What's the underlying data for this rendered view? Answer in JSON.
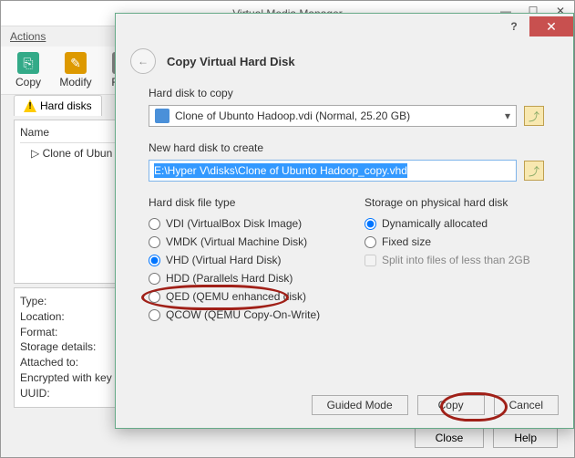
{
  "bg": {
    "title": "Virtual Media Manager",
    "menu_actions": "Actions",
    "toolbar": {
      "copy": "Copy",
      "modify": "Modify",
      "remove": "Rem"
    },
    "tab_hard_disks": "Hard disks",
    "tree_header": "Name",
    "tree_item": "Clone of Ubun",
    "details": {
      "type": "Type:",
      "location": "Location:",
      "format": "Format:",
      "storage": "Storage details:",
      "attached": "Attached to:",
      "encrypted": "Encrypted with key",
      "uuid": "UUID:"
    },
    "close_btn": "Close",
    "help_btn": "Help"
  },
  "dlg": {
    "header_title": "Copy Virtual Hard Disk",
    "copy_label": "Hard disk to copy",
    "copy_value": "Clone of Ubunto Hadoop.vdi (Normal, 25.20 GB)",
    "new_label": "New hard disk to create",
    "new_value": "E:\\Hyper V\\disks\\Clone of Ubunto Hadoop_copy.vhd",
    "file_type_label": "Hard disk file type",
    "file_types": {
      "vdi": "VDI (VirtualBox Disk Image)",
      "vmdk": "VMDK (Virtual Machine Disk)",
      "vhd": "VHD (Virtual Hard Disk)",
      "hdd": "HDD (Parallels Hard Disk)",
      "qed": "QED (QEMU enhanced disk)",
      "qcow": "QCOW (QEMU Copy-On-Write)"
    },
    "storage_label": "Storage on physical hard disk",
    "storage": {
      "dynamic": "Dynamically allocated",
      "fixed": "Fixed size",
      "split": "Split into files of less than 2GB"
    },
    "buttons": {
      "guided": "Guided Mode",
      "copy": "Copy",
      "cancel": "Cancel"
    }
  }
}
